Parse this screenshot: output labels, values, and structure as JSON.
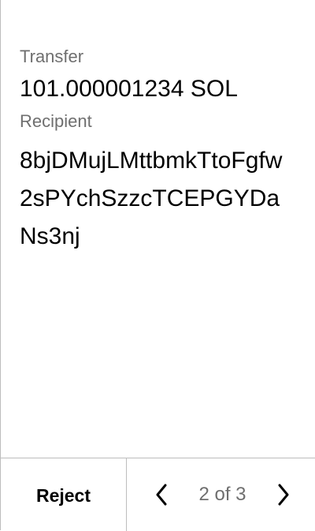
{
  "transfer": {
    "label": "Transfer",
    "amount": "101.000001234 SOL"
  },
  "recipient": {
    "label": "Recipient",
    "address": "8bjDMujLMttbmkTtoFgfw2sPYchSzzcTCEPGYDaNs3nj"
  },
  "footer": {
    "reject_label": "Reject",
    "page_indicator": "2 of 3",
    "prev_icon": "chevron-left-icon",
    "next_icon": "chevron-right-icon"
  },
  "colors": {
    "text": "#000000",
    "muted": "#6f6f6f",
    "divider": "#bdbdbd",
    "background": "#ffffff"
  }
}
